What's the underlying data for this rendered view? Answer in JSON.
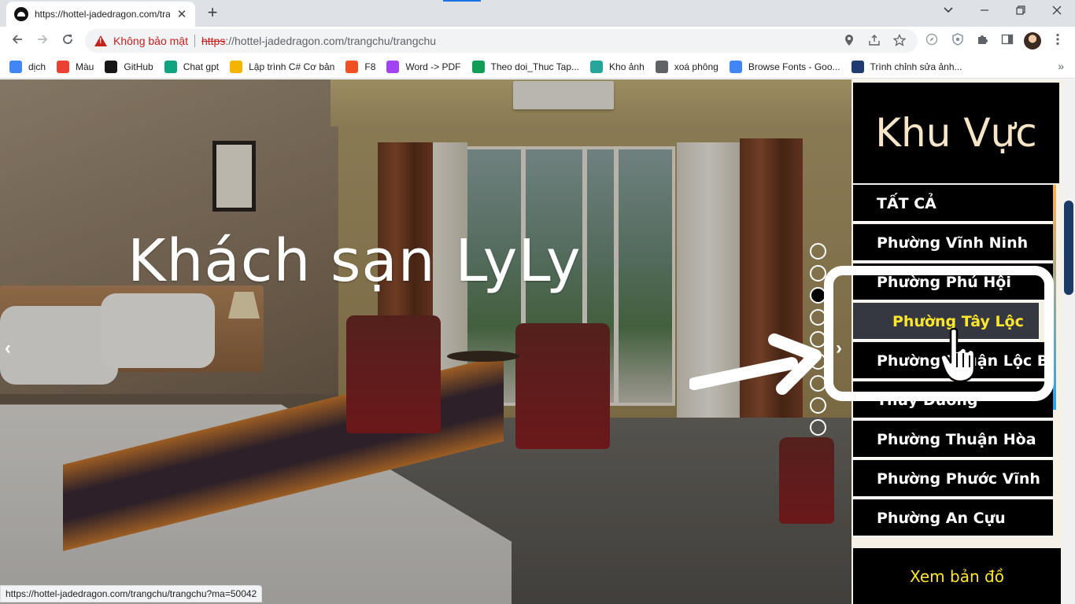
{
  "browser": {
    "tab_title": "https://hottel-jadedragon.com/trangchu/trangchu",
    "tab_close": "✕",
    "new_tab": "+",
    "security_label": "Không bảo mật",
    "url_protocol": "https",
    "url_rest": "://hottel-jadedragon.com/trangchu/trangchu",
    "status_url": "https://hottel-jadedragon.com/trangchu/trangchu?ma=50042"
  },
  "bookmarks": [
    {
      "label": "dịch",
      "icon": "google-translate-icon",
      "color": "#4285f4"
    },
    {
      "label": "Màu",
      "icon": "color-palette-icon",
      "color": "#e94235"
    },
    {
      "label": "GitHub",
      "icon": "github-icon",
      "color": "#181717"
    },
    {
      "label": "Chat gpt",
      "icon": "chatgpt-icon",
      "color": "#10a37f"
    },
    {
      "label": "Lập trình C# Cơ bản",
      "icon": "code-icon",
      "color": "#f4b400"
    },
    {
      "label": "F8",
      "icon": "f8-icon",
      "color": "#f05123"
    },
    {
      "label": "Word -> PDF",
      "icon": "word-pdf-icon",
      "color": "#a142f4"
    },
    {
      "label": "Theo doi_Thuc Tap...",
      "icon": "sheets-icon",
      "color": "#0f9d58"
    },
    {
      "label": "Kho ảnh",
      "icon": "image-store-icon",
      "color": "#26a69a"
    },
    {
      "label": "xoá phông",
      "icon": "background-remove-icon",
      "color": "#5f6368"
    },
    {
      "label": "Browse Fonts - Goo...",
      "icon": "google-fonts-icon",
      "color": "#4285f4"
    },
    {
      "label": "Trình chỉnh sửa ảnh...",
      "icon": "photo-editor-icon",
      "color": "#1f3b6f"
    }
  ],
  "bookmarks_more": "»",
  "hero": {
    "title": "Khách sạn LyLy",
    "prev": "‹",
    "next": "›",
    "slide_count": 9,
    "active_slide": 3
  },
  "sidebar": {
    "heading": "Khu Vực",
    "items": [
      {
        "label": "TẤT CẢ"
      },
      {
        "label": "Phường Vĩnh Ninh"
      },
      {
        "label": "Phường Phú Hội"
      },
      {
        "label": "Phường Tây Lộc",
        "state": "hover"
      },
      {
        "label": "Phường Thuận Lộc Ba"
      },
      {
        "label": "Thủy Dương"
      },
      {
        "label": "Phường Thuận Hòa"
      },
      {
        "label": "Phường Phước Vĩnh"
      },
      {
        "label": "Phường An Cựu"
      }
    ],
    "map_button": "Xem bản đồ"
  },
  "colors": {
    "accent_yellow": "#ffe62e",
    "heading_cream": "#f6e5c6",
    "danger": "#c5221f"
  }
}
